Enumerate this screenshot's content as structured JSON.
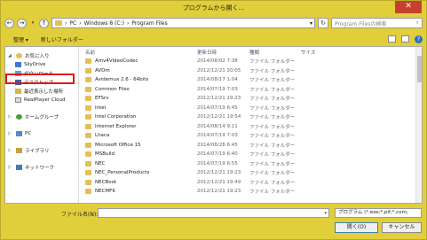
{
  "window": {
    "title": "プログラムから開く..."
  },
  "address": {
    "path": [
      "PC",
      "Windows 8 (C:)",
      "Program Files"
    ],
    "search_placeholder": "Program Filesの検索"
  },
  "toolbar": {
    "organize": "整理 ▾",
    "new_folder": "新しいフォルダー"
  },
  "navpane": {
    "favorites": "お気に入り",
    "skydrive": "SkyDrive",
    "downloads": "ダウンロード",
    "desktop": "デスクトップ",
    "recent": "最近表示した場所",
    "realplayer": "RealPlayer Cloud",
    "homegroup": "ホームグループ",
    "pc": "PC",
    "libraries": "ライブラリ",
    "network": "ネットワーク"
  },
  "columns": {
    "name": "名前",
    "date": "更新日時",
    "type": "種類",
    "size": "サイズ"
  },
  "files": [
    {
      "name": "Amv4VideoCodec",
      "date": "2014/08/02 7:38",
      "type": "ファイル フォルダー"
    },
    {
      "name": "AVDm",
      "date": "2012/12/21 20:05",
      "type": "ファイル フォルダー"
    },
    {
      "name": "Avidemux 2.6 - 64bits",
      "date": "2014/08/17 1:04",
      "type": "ファイル フォルダー"
    },
    {
      "name": "Common Files",
      "date": "2014/07/19 7:03",
      "type": "ファイル フォルダー"
    },
    {
      "name": "EFSrv",
      "date": "2012/12/21 19:23",
      "type": "ファイル フォルダー"
    },
    {
      "name": "Intel",
      "date": "2014/07/19 6:45",
      "type": "ファイル フォルダー"
    },
    {
      "name": "Intel Corporation",
      "date": "2012/12/21 19:54",
      "type": "ファイル フォルダー"
    },
    {
      "name": "Internet Explorer",
      "date": "2014/08/14 9:11",
      "type": "ファイル フォルダー"
    },
    {
      "name": "Lhaca",
      "date": "2014/07/19 7:03",
      "type": "ファイル フォルダー"
    },
    {
      "name": "Microsoft Office 15",
      "date": "2014/08/28 6:45",
      "type": "ファイル フォルダー"
    },
    {
      "name": "MSBuild",
      "date": "2014/07/19 6:40",
      "type": "ファイル フォルダー"
    },
    {
      "name": "NEC",
      "date": "2014/07/19 6:55",
      "type": "ファイル フォルダー"
    },
    {
      "name": "NEC_PersonalProducts",
      "date": "2012/12/21 19:23",
      "type": "ファイル フォルダー"
    },
    {
      "name": "NECBoot",
      "date": "2012/12/21 19:49",
      "type": "ファイル フォルダー"
    },
    {
      "name": "NECMFK",
      "date": "2012/12/21 19:23",
      "type": "ファイル フォルダー"
    }
  ],
  "bottom": {
    "filename_label": "ファイル名(N):",
    "filename_value": "",
    "filter": "プログラム (*.exe;*.pif;*.com;",
    "open": "開く(O)",
    "cancel": "キャンセル"
  }
}
